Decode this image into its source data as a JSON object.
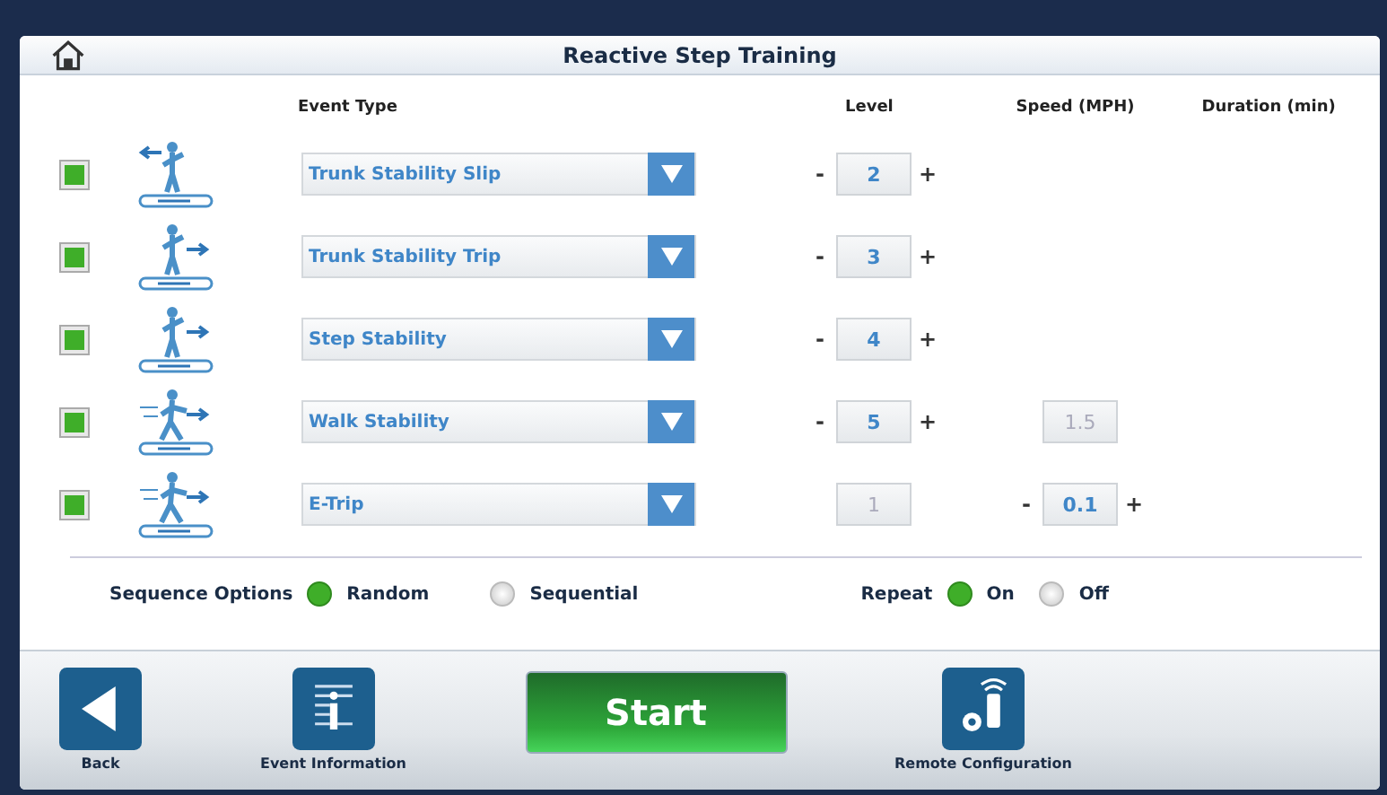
{
  "window": {
    "title": "Reactive Step Training"
  },
  "columns": [
    "Event Type",
    "Level",
    "Speed (MPH)",
    "Duration (min)"
  ],
  "rows": [
    {
      "checked": true,
      "kind": "slip",
      "event_type": "Trunk Stability Slip",
      "level": {
        "value": "2",
        "editable": true
      }
    },
    {
      "checked": true,
      "kind": "trip",
      "event_type": "Trunk Stability Trip",
      "level": {
        "value": "3",
        "editable": true
      }
    },
    {
      "checked": true,
      "kind": "step",
      "event_type": "Step Stability",
      "level": {
        "value": "4",
        "editable": true
      }
    },
    {
      "checked": true,
      "kind": "walk",
      "event_type": "Walk Stability",
      "level": {
        "value": "5",
        "editable": true
      },
      "speed": {
        "value": "1.5",
        "editable": false
      }
    },
    {
      "checked": true,
      "kind": "etrip",
      "event_type": "E-Trip",
      "level": {
        "value": "1",
        "editable": false
      },
      "speed": {
        "value": "0.1",
        "editable": true
      }
    }
  ],
  "stepper": {
    "minus": "-",
    "plus": "+"
  },
  "sequence_options": {
    "label": "Sequence Options",
    "options": [
      {
        "label": "Random",
        "selected": true
      },
      {
        "label": "Sequential",
        "selected": false
      }
    ]
  },
  "repeat": {
    "label": "Repeat",
    "options": [
      {
        "label": "On",
        "selected": true
      },
      {
        "label": "Off",
        "selected": false
      }
    ]
  },
  "footer": {
    "back": "Back",
    "event_information": "Event Information",
    "start": "Start",
    "remote_configuration": "Remote Configuration"
  }
}
